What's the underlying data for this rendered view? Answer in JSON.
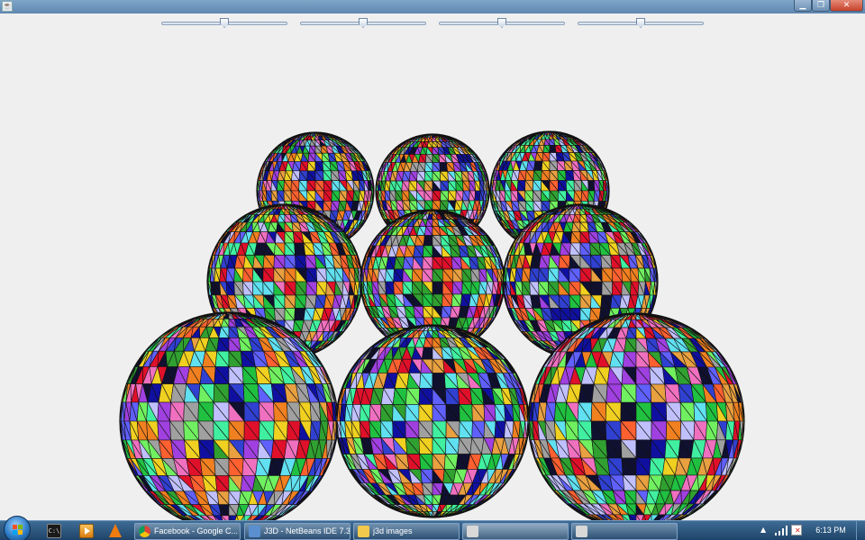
{
  "window": {
    "title": "",
    "icon": "java-cup-icon",
    "controls": {
      "minimize_icon": "minimize-icon",
      "maximize_icon": "restore-icon",
      "close_icon": "close-icon"
    }
  },
  "sliders": [
    {
      "name": "slider-1",
      "value": 0.5
    },
    {
      "name": "slider-2",
      "value": 0.5
    },
    {
      "name": "slider-3",
      "value": 0.5
    },
    {
      "name": "slider-4",
      "value": 0.5
    }
  ],
  "scene": {
    "description_kind": "3d-sphere-grid",
    "rows": 3,
    "columns": 3,
    "face_colors": [
      "#e0102a",
      "#f08020",
      "#f0d020",
      "#20c040",
      "#3040d0",
      "#1010a0",
      "#a040e0",
      "#60e0f0",
      "#f070c0",
      "#40f0a0",
      "#30a030",
      "#6060ff",
      "#c0c0ff",
      "#ff6030",
      "#70f060",
      "#101030",
      "#a0a0a0",
      "#e8a040"
    ]
  },
  "taskbar": {
    "start_icon": "windows-start-icon",
    "quick_launch": [
      {
        "name": "cmd-icon",
        "label": "C:\\"
      },
      {
        "name": "media-player-icon"
      },
      {
        "name": "vlc-icon"
      }
    ],
    "tasks": [
      {
        "label": "Facebook - Google C...",
        "icon": "chrome-icon",
        "color": "#dd4433"
      },
      {
        "label": "J3D - NetBeans IDE 7.3",
        "icon": "netbeans-icon",
        "color": "#5a8fd0"
      },
      {
        "label": "j3d images",
        "icon": "folder-icon",
        "color": "#f2c94c"
      },
      {
        "label": "",
        "icon": "java-icon",
        "color": "#d8d8d8"
      },
      {
        "label": "",
        "icon": "java-icon",
        "color": "#d8d8d8"
      }
    ],
    "tray": {
      "expand_icon": "tray-up-arrow-icon",
      "signal_icon": "network-signal-icon",
      "action_center_icon": "action-center-flag-icon",
      "time": "6:13 PM"
    }
  }
}
